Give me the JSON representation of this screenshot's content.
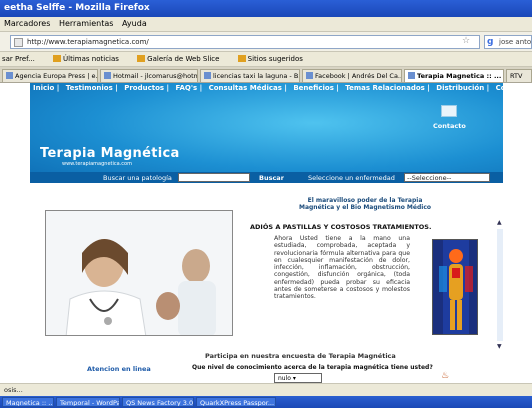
{
  "window": {
    "title": "eetha Selffe - Mozilla Firefox"
  },
  "menu": [
    "Marcadores",
    "Herramientas",
    "Ayuda"
  ],
  "address": {
    "url": "http://www.terapiamagnetica.com/",
    "search_value": "jose antonio"
  },
  "bookmarks": [
    "sar Pref...",
    "Últimas noticias",
    "Galería de Web Slice",
    "Sitios sugeridos"
  ],
  "tabs": [
    {
      "label": "Agencia Europa Press | e..."
    },
    {
      "label": "Hotmail - jlcomarus@hotm..."
    },
    {
      "label": "licencias taxi la laguna - B..."
    },
    {
      "label": "Facebook | Andrés Del Ca..."
    },
    {
      "label": "Terapia Magnetica :: ..."
    },
    {
      "label": "RTV"
    }
  ],
  "nav": [
    "Inicio |",
    "Testimonios |",
    "Productos |",
    "FAQ's |",
    "Consultas Médicas |",
    "Beneficios |",
    "Temas Relacionados |",
    "Distribución |",
    "Comprar"
  ],
  "header": {
    "title": "Terapia Magnética",
    "subtitle": "www.terapiamagnetica.com",
    "contacto": "Contacto",
    "search_label": "Buscar una patología",
    "search_button": "Buscar",
    "select_label": "Seleccione un enfermedad",
    "select_value": "--Seleccione--"
  },
  "tagline": "El maravilloso poder de la Terapia Magnética y el Bio Magnetismo Médico",
  "article": {
    "title": "ADIÓS A PASTILLAS Y COSTOSOS TRATAMIENTOS.",
    "text": "Ahora Usted tiene a la mano una estudiada, comprobada, aceptada y revolucionaria fórmula alternativa para que en cualesquier manifestación de dolor, infección, inflamación, obstrucción, congestión, disfunción orgánica, (toda enfermedad) pueda probar su eficacia antes de someterse a costosos y molestos tratamientos."
  },
  "survey": {
    "title": "Participa en nuestra encuesta de Terapia Magnética",
    "question": "Que nivel de conocimiento acerca de la terapia magnética tiene usted?",
    "selected": "nulo"
  },
  "atencion": "Atencion en linea",
  "status": "osis...",
  "taskbar": [
    "Magnetica :: ...",
    "Temporal - WordPad",
    "QS News Factory 3.0",
    "QuarkXPress Passpor..."
  ]
}
